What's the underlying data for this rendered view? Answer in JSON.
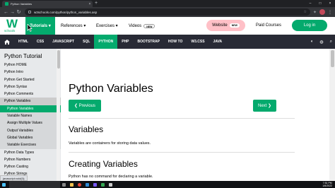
{
  "browser": {
    "tab_title": "Python Variables",
    "tab_close": "×",
    "new_tab": "+",
    "url": "w3schools.com/python/python_variables.asp",
    "window_controls": [
      "–",
      "□",
      "×"
    ]
  },
  "header": {
    "logo_letter": "W",
    "logo_sub": "schools",
    "tutorials_label": "Tutorials ▾",
    "references_label": "References ▾",
    "exercises_label": "Exercises ▾",
    "videos_label": "Videos",
    "new_badge": "NEW",
    "website_label": "Website",
    "website_badge": "NEW",
    "paid_courses_label": "Paid Courses",
    "login_label": "Log in"
  },
  "subnav": {
    "items": [
      "HTML",
      "CSS",
      "JAVASCRIPT",
      "SQL",
      "PYTHON",
      "PHP",
      "BOOTSTRAP",
      "HOW TO",
      "W3.CSS",
      "JAVA"
    ],
    "active": "PYTHON"
  },
  "sidebar": {
    "title": "Python Tutorial",
    "items": [
      "Python HOME",
      "Python Intro",
      "Python Get Started",
      "Python Syntax",
      "Python Comments",
      "Python Variables",
      "Python Variables",
      "Variable Names",
      "Assign Multiple Values",
      "Output Variables",
      "Global Variables",
      "Variable Exercises",
      "Python Data Types",
      "Python Numbers",
      "Python Casting",
      "Python Strings"
    ]
  },
  "main": {
    "title": "Python Variables",
    "prev_label": "❮ Previous",
    "next_label": "Next ❯",
    "section1_heading": "Variables",
    "section1_text": "Variables are containers for storing data values.",
    "section2_heading": "Creating Variables",
    "section2_text": "Python has no command for declaring a variable."
  },
  "status": {
    "link_text": "javascript:void(0);"
  },
  "taskbar": {
    "time": "7:51 PM",
    "date": "1/6/2022"
  },
  "colors": {
    "brand_green": "#04aa6d",
    "dark_nav": "#282a35",
    "sidebar_bg": "#e7e9eb",
    "pink": "#ffc0c7"
  }
}
